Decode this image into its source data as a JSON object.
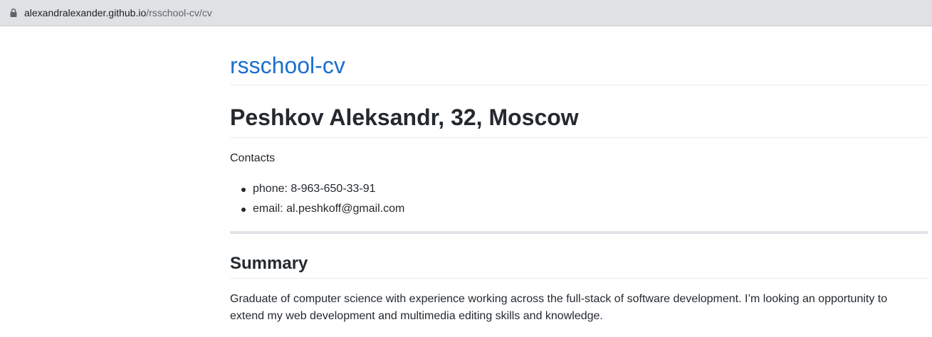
{
  "browser": {
    "url_host": "alexandralexander.github.io",
    "url_path": "/rsschool-cv/cv"
  },
  "site": {
    "title": "rsschool-cv"
  },
  "cv": {
    "heading": "Peshkov Aleksandr, 32, Moscow",
    "contacts_label": "Contacts",
    "contacts": [
      "phone: 8-963-650-33-91",
      "email: al.peshkoff@gmail.com"
    ],
    "summary_heading": "Summary",
    "summary_text": "Graduate of computer science with experience working across the full-stack of software development. I’m looking an opportunity to extend my web development and multimedia editing skills and knowledge."
  },
  "colors": {
    "link": "#1b6fd0",
    "text": "#24292e",
    "rule": "#eaecef",
    "thick_rule": "#e1e4e8"
  },
  "icons": {
    "lock": "lock-icon"
  }
}
